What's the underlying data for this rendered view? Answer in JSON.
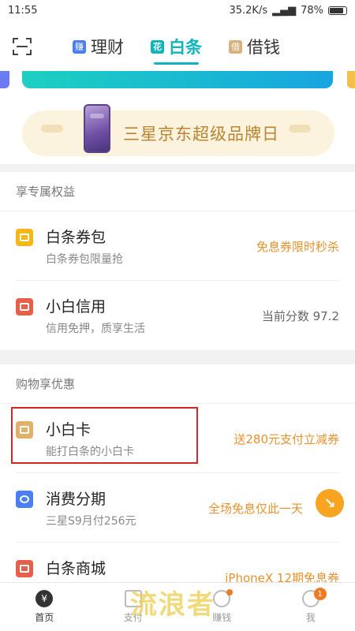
{
  "status_bar": {
    "time": "11:55",
    "speed": "35.2K/s",
    "battery": "78%"
  },
  "tabs": [
    {
      "badge": "赚",
      "label": "理财",
      "color": "#4a7ff0"
    },
    {
      "badge": "花",
      "label": "白条",
      "color": "#10b5bc"
    },
    {
      "badge": "借",
      "label": "借钱",
      "color": "#d9b27b"
    }
  ],
  "promo": {
    "text": "三星京东超级品牌日"
  },
  "section1": {
    "title": "享专属权益",
    "rows": [
      {
        "icon": "coupon-bag-icon",
        "title": "白条券包",
        "subtitle": "白条券包限量抢",
        "right": "免息券限时秒杀",
        "color": "#f5b618"
      },
      {
        "icon": "credit-icon",
        "title": "小白信用",
        "subtitle": "信用免押，质享生活",
        "right": "当前分数 97.2",
        "color": "#e5604a"
      }
    ]
  },
  "section2": {
    "title": "购物享优惠",
    "rows": [
      {
        "icon": "card-icon",
        "title": "小白卡",
        "subtitle": "能打白条的小白卡",
        "right": "送280元支付立减券",
        "color": "#e0b16a"
      },
      {
        "icon": "clock-icon",
        "title": "消费分期",
        "subtitle": "三星S9月付256元",
        "right": "全场免息仅此一天",
        "color": "#4a7ff0"
      },
      {
        "icon": "mall-icon",
        "title": "白条商城",
        "subtitle": "",
        "right": "iPhoneX 12期免息券",
        "color": "#e5604a"
      }
    ]
  },
  "bottom_nav": [
    {
      "label": "首页",
      "icon": "home-icon"
    },
    {
      "label": "支付",
      "icon": "pay-icon"
    },
    {
      "label": "赚钱",
      "icon": "earn-icon"
    },
    {
      "label": "我",
      "icon": "profile-icon",
      "count": "1"
    }
  ],
  "watermark": "流浪者"
}
